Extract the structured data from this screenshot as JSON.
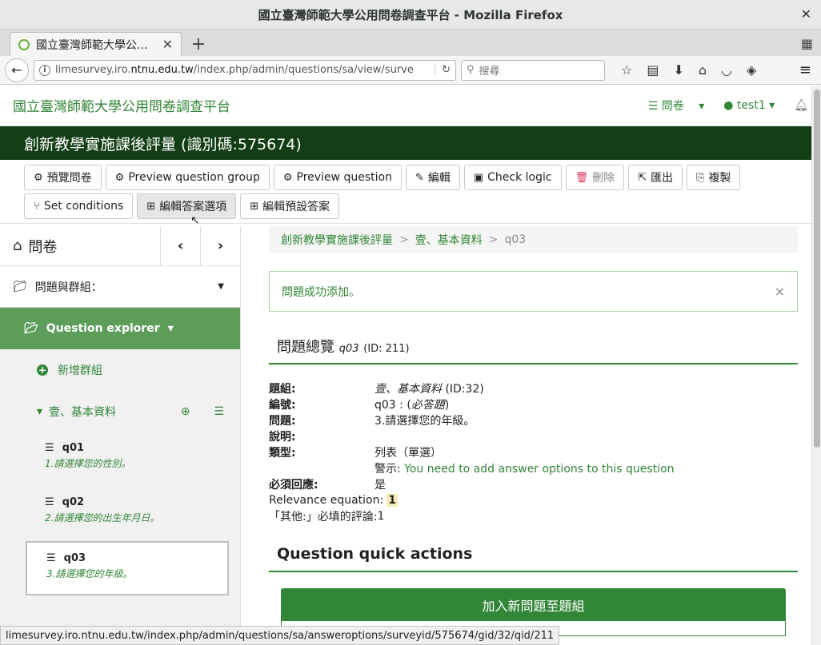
{
  "window": {
    "title": "國立臺灣師範大學公用問卷調查平台 - Mozilla Firefox",
    "close_glyph": "✕"
  },
  "browser": {
    "tab_label": "國立臺灣師範大學公...",
    "tab_close": "✕",
    "new_tab": "+",
    "url_prefix": "limesurvey.iro.",
    "url_domain": "ntnu.edu.tw",
    "url_rest": "/index.php/admin/questions/sa/view/surve",
    "search_placeholder": "搜尋",
    "status_url": "limesurvey.iro.ntnu.edu.tw/index.php/admin/questions/sa/answeroptions/surveyid/575674/gid/32/qid/211"
  },
  "app": {
    "brand": "國立臺灣師範大學公用問卷調查平台",
    "surveys_menu": "問卷",
    "user_menu": "test1"
  },
  "survey": {
    "title": "創新教學實施課後評量 (識別碼:575674)"
  },
  "toolbar": {
    "row1": [
      "預覽問卷",
      "Preview question group",
      "Preview question",
      "編輯",
      "Check logic",
      "刪除",
      "匯出",
      "複製"
    ],
    "row2": [
      "Set conditions",
      "編輯答案選項",
      "編輯預設答案"
    ]
  },
  "sidebar": {
    "title": "問卷",
    "groups_label": "問題與群組：",
    "explorer_label": "Question explorer",
    "add_group": "新增群組",
    "group_name": "壹、基本資料",
    "questions": [
      {
        "code": "q01",
        "text": "1.請選擇您的性別。"
      },
      {
        "code": "q02",
        "text": "2.請選擇您的出生年月日。"
      },
      {
        "code": "q03",
        "text": "3.請選擇您的年級。"
      }
    ]
  },
  "breadcrumb": {
    "survey": "創新教學實施課後評量",
    "group": "壹、基本資料",
    "question": "q03",
    "sep": ">"
  },
  "alert": {
    "message": "問題成功添加。",
    "close": "×"
  },
  "overview": {
    "title": "問題總覽",
    "code": "q03",
    "id": "(ID: 211)",
    "rows": {
      "group_label": "題組:",
      "group_name": "壹、基本資料",
      "group_id": "(ID:32)",
      "code_label": "編號:",
      "code_value": "q03 : (",
      "code_required": "必答題",
      "code_close": ")",
      "question_label": "問題:",
      "question_value": "3.請選擇您的年級。",
      "desc_label": "說明:",
      "type_label": "類型:",
      "type_value": "列表（單選）",
      "warn_prefix": "警示: ",
      "warn_text": "You need to add answer options to this question",
      "mandatory_label": "必須回應:",
      "mandatory_value": "是",
      "relevance_label": "Relevance equation:",
      "relevance_value": "1",
      "other_label": "「其他:」必填的評論:",
      "other_value": "1"
    }
  },
  "quick_actions": {
    "title": "Question quick actions",
    "add_question": "加入新問題至題組"
  }
}
